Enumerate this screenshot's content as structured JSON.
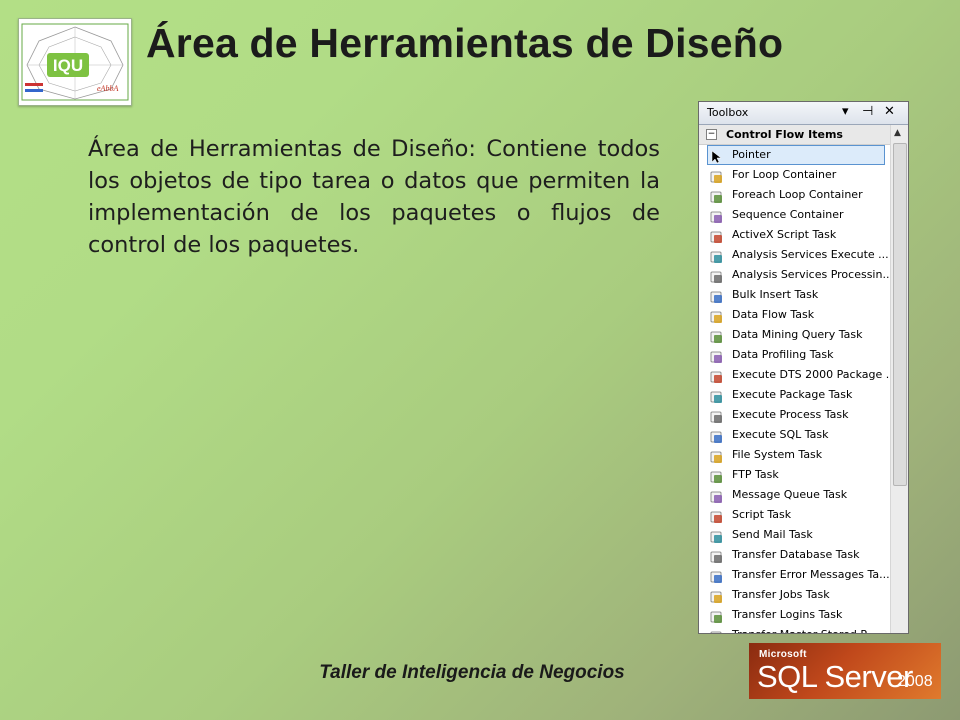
{
  "slide": {
    "title": "Área de Herramientas de Diseño",
    "body": "Área de Herramientas de Diseño: Contiene todos los objetos de tipo tarea o datos que permiten la implementación de los paquetes o flujos de control de los paquetes.",
    "footer": "Taller de Inteligencia de Negocios"
  },
  "logo": {
    "text": "IQU",
    "brand": "eAbbA"
  },
  "toolbox": {
    "title": "Toolbox",
    "controls": {
      "dropdown": "▾",
      "pin": "⊣",
      "close": "✕"
    },
    "group_header": "Control Flow Items",
    "collapse_glyph": "−",
    "items": [
      {
        "label": "Pointer",
        "icon": "pointer-icon"
      },
      {
        "label": "For Loop Container",
        "icon": "for-loop-icon"
      },
      {
        "label": "Foreach Loop Container",
        "icon": "foreach-loop-icon"
      },
      {
        "label": "Sequence Container",
        "icon": "sequence-container-icon"
      },
      {
        "label": "ActiveX Script Task",
        "icon": "activex-icon"
      },
      {
        "label": "Analysis Services Execute ...",
        "icon": "analysis-execute-icon"
      },
      {
        "label": "Analysis Services Processin...",
        "icon": "analysis-processing-icon"
      },
      {
        "label": "Bulk Insert Task",
        "icon": "bulk-insert-icon"
      },
      {
        "label": "Data Flow Task",
        "icon": "data-flow-icon"
      },
      {
        "label": "Data Mining Query Task",
        "icon": "data-mining-icon"
      },
      {
        "label": "Data Profiling Task",
        "icon": "data-profiling-icon"
      },
      {
        "label": "Execute DTS 2000 Package ...",
        "icon": "execute-dts-icon"
      },
      {
        "label": "Execute Package Task",
        "icon": "execute-package-icon"
      },
      {
        "label": "Execute Process Task",
        "icon": "execute-process-icon"
      },
      {
        "label": "Execute SQL Task",
        "icon": "execute-sql-icon"
      },
      {
        "label": "File System Task",
        "icon": "file-system-icon"
      },
      {
        "label": "FTP Task",
        "icon": "ftp-icon"
      },
      {
        "label": "Message Queue Task",
        "icon": "message-queue-icon"
      },
      {
        "label": "Script Task",
        "icon": "script-icon"
      },
      {
        "label": "Send Mail Task",
        "icon": "send-mail-icon"
      },
      {
        "label": "Transfer Database Task",
        "icon": "transfer-database-icon"
      },
      {
        "label": "Transfer Error Messages Ta...",
        "icon": "transfer-error-icon"
      },
      {
        "label": "Transfer Jobs Task",
        "icon": "transfer-jobs-icon"
      },
      {
        "label": "Transfer Logins Task",
        "icon": "transfer-logins-icon"
      },
      {
        "label": "Transfer Master Stored P...",
        "icon": "transfer-master-icon"
      }
    ],
    "selected_index": 0,
    "scroll_up_glyph": "▲"
  },
  "sql_logo": {
    "vendor": "Microsoft",
    "product": "SQL Server",
    "version": "2008"
  },
  "colors": {
    "background_start": "#b3df86",
    "background_end": "#8d9a72",
    "selection": "#dcebfa",
    "selection_border": "#5a93d0",
    "sql_orange": "#c0481b"
  }
}
